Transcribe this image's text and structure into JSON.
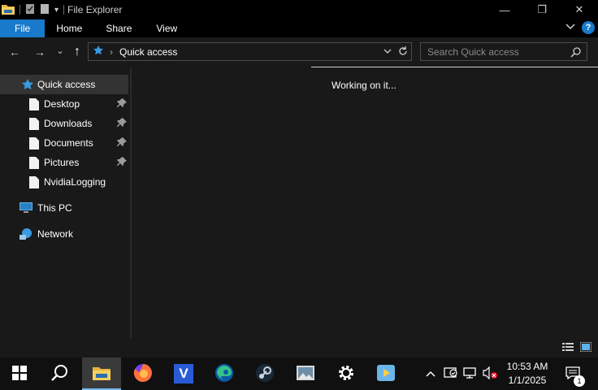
{
  "window": {
    "title": "File Explorer",
    "controls": {
      "minimize": "—",
      "maximize": "❐",
      "close": "✕"
    }
  },
  "ribbon": {
    "tabs": [
      "File",
      "Home",
      "Share",
      "View"
    ],
    "help": "?"
  },
  "navigation": {
    "back": "←",
    "forward": "→",
    "recent": "⌄",
    "up": "↑"
  },
  "address": {
    "separator": "›",
    "path": "Quick access"
  },
  "search": {
    "placeholder": "Search Quick access"
  },
  "nav_pane": {
    "quick_access": "Quick access",
    "items": [
      {
        "label": "Desktop",
        "pinned": true
      },
      {
        "label": "Downloads",
        "pinned": true
      },
      {
        "label": "Documents",
        "pinned": true
      },
      {
        "label": "Pictures",
        "pinned": true
      },
      {
        "label": "NvidiaLogging",
        "pinned": false
      }
    ],
    "this_pc": "This PC",
    "network": "Network"
  },
  "main": {
    "status_message": "Working on it..."
  },
  "taskbar": {
    "apps": [
      "start-icon",
      "search-icon",
      "file-explorer-icon",
      "firefox-icon",
      "v-app-icon",
      "edge-icon",
      "steam-icon",
      "image-app-icon",
      "settings-icon",
      "media-player-icon"
    ],
    "v_app_letter": "V",
    "time": "10:53 AM",
    "date": "1/1/2025",
    "notification_count": "1"
  },
  "colors": {
    "accent": "#1979ca",
    "background": "#191919",
    "titlebar": "#000000"
  }
}
